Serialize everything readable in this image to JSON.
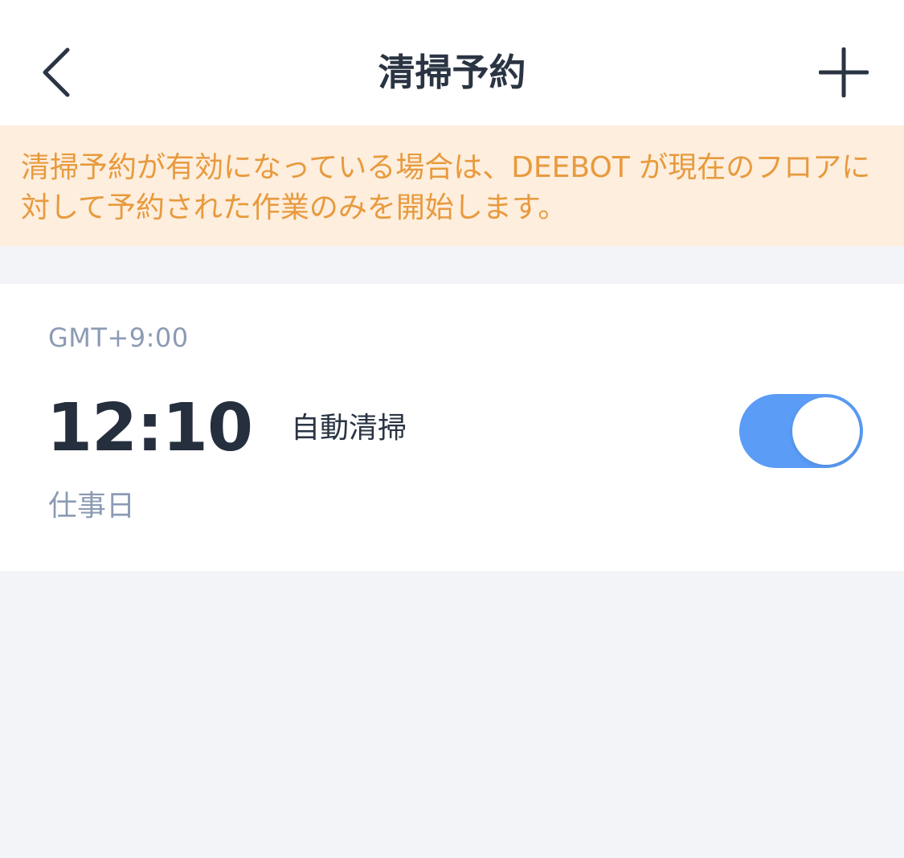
{
  "header": {
    "title": "清掃予約",
    "back_icon": "chevron-left-icon",
    "add_icon": "plus-icon"
  },
  "notice": {
    "text": "清掃予約が有効になっている場合は、DEEBOT が現在のフロアに対して予約された作業のみを開始します。"
  },
  "schedules": [
    {
      "timezone": "GMT+9:00",
      "time": "12:10",
      "mode": "自動清掃",
      "days": "仕事日",
      "enabled": true
    }
  ],
  "colors": {
    "accent": "#5b9cf6",
    "notice_text": "#e89a3d",
    "notice_bg": "#fdeede",
    "title_text": "#2a3443",
    "secondary_text": "#8c9bb4"
  }
}
